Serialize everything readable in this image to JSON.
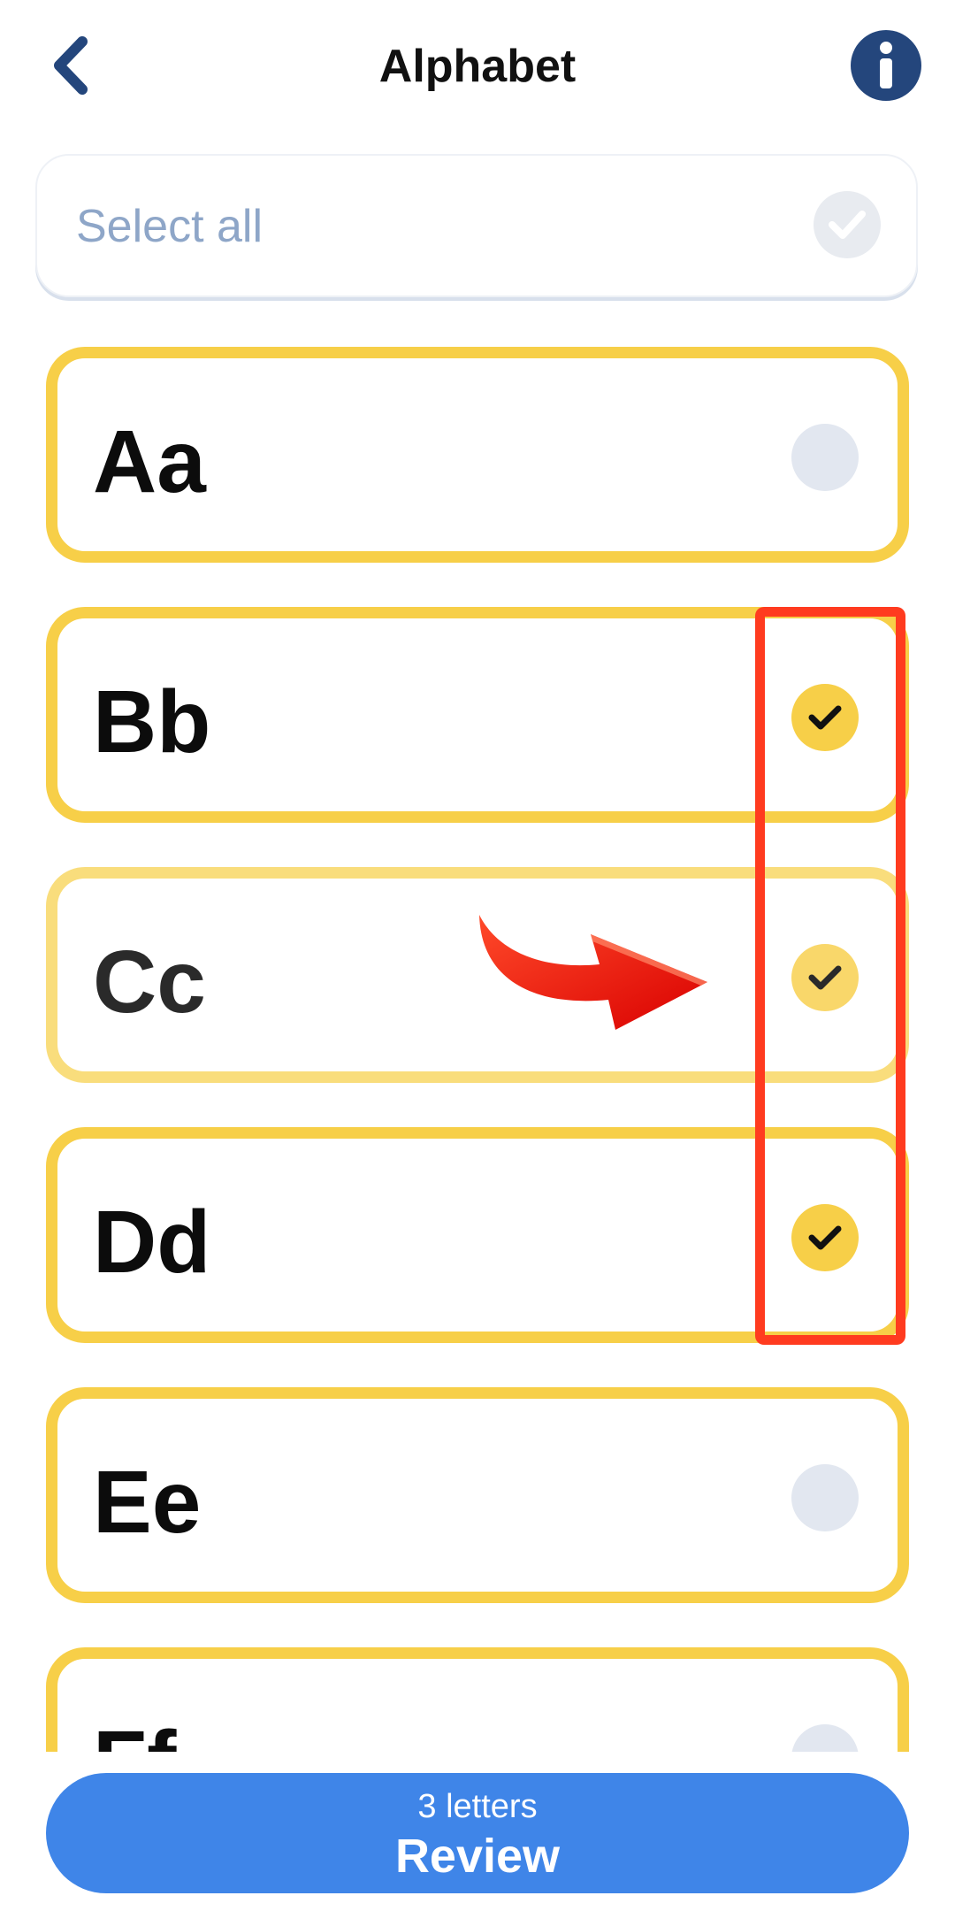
{
  "header": {
    "title": "Alphabet",
    "back_icon": "chevron-left-icon",
    "info_icon": "info-icon"
  },
  "select_all": {
    "label": "Select all",
    "checked": false
  },
  "letters": [
    {
      "label": "Aa",
      "checked": false
    },
    {
      "label": "Bb",
      "checked": true
    },
    {
      "label": "Cc",
      "checked": true
    },
    {
      "label": "Dd",
      "checked": true
    },
    {
      "label": "Ee",
      "checked": false
    },
    {
      "label": "Ff",
      "checked": false
    }
  ],
  "review": {
    "count_text": "3 letters",
    "label": "Review"
  },
  "colors": {
    "accent_yellow": "#f7cf48",
    "primary_blue": "#3f85e8",
    "header_icon": "#24467c",
    "annotation_red": "#ff3b1f"
  }
}
